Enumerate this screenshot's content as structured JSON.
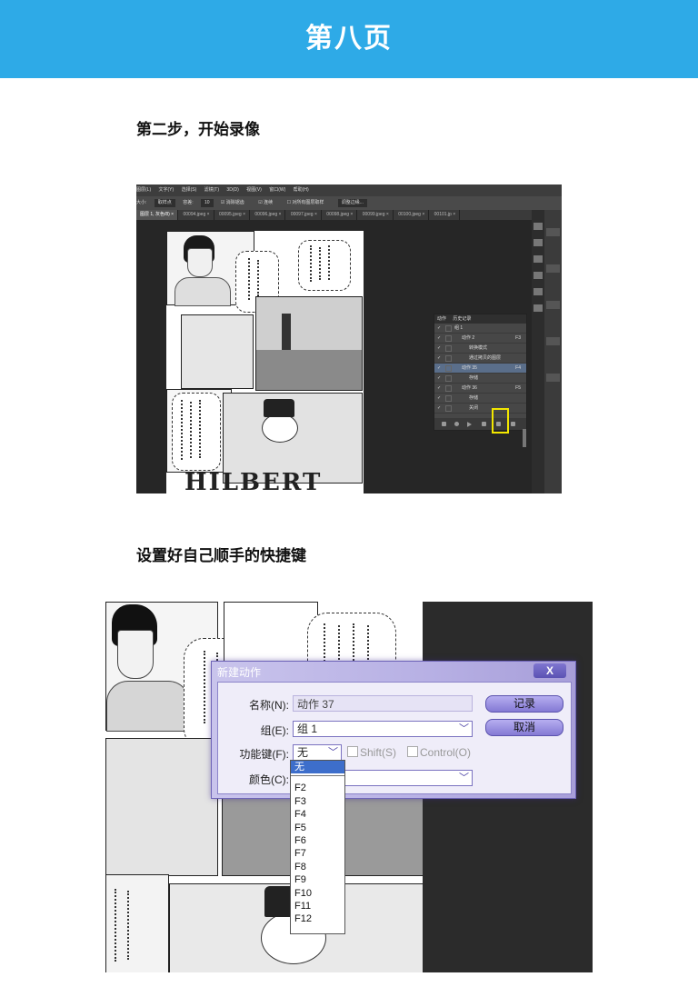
{
  "header": {
    "title": "第八页",
    "color": "#2eaae7"
  },
  "steps": {
    "step1": "第二步，开始录像",
    "step2": "设置好自己顺手的快捷键"
  },
  "ps": {
    "menus": [
      "图层(L)",
      "文字(Y)",
      "选择(S)",
      "滤镜(T)",
      "3D(D)",
      "视图(V)",
      "窗口(W)",
      "帮助(H)"
    ],
    "options": {
      "size_label": "大小:",
      "sample_select": "取样点",
      "tolerance_label": "容差:",
      "tolerance_value": "10",
      "antialias": "消除锯齿",
      "contiguous": "连续",
      "all_layers": "对所有图层取样",
      "refine_button": "调整边缘..."
    },
    "tabs": [
      "图层 1, 灰色/8) ×",
      "00094.jpeg ×",
      "00095.jpeg ×",
      "00096.jpeg ×",
      "00097.jpeg ×",
      "00098.jpeg ×",
      "00099.jpeg ×",
      "00100.jpeg ×",
      "00101.jp ×"
    ],
    "panel_tabs": [
      "动作",
      "历史记录"
    ],
    "actions": [
      {
        "label": "组 1",
        "key": "",
        "indent": 22
      },
      {
        "label": "动作 2",
        "key": "F3",
        "indent": 30
      },
      {
        "label": "转换模式",
        "key": "",
        "indent": 38
      },
      {
        "label": "通过拷贝的图层",
        "key": "",
        "indent": 38
      },
      {
        "label": "动作 35",
        "key": "F4",
        "indent": 30
      },
      {
        "label": "存储",
        "key": "",
        "indent": 38
      },
      {
        "label": "动作 36",
        "key": "F5",
        "indent": 30
      },
      {
        "label": "存储",
        "key": "",
        "indent": 38
      },
      {
        "label": "关闭",
        "key": "",
        "indent": 38
      }
    ],
    "highlight_color": "#f2e600"
  },
  "manga": {
    "title1": "HILBERT",
    "title2": "HILBERT"
  },
  "dialog": {
    "title": "新建动作",
    "close_label": "X",
    "name_label": "名称(N):",
    "name_value": "动作 37",
    "group_label": "组(E):",
    "group_value": "组 1",
    "fkey_label": "功能键(F):",
    "fkey_value": "无",
    "shift_label": "Shift(S)",
    "control_label": "Control(O)",
    "color_label": "颜色(C):",
    "color_value": "",
    "record_button": "记录",
    "cancel_button": "取消",
    "accent_color": "#8479d4"
  },
  "dropdown_options": [
    "无",
    "F2",
    "F3",
    "F4",
    "F5",
    "F6",
    "F7",
    "F8",
    "F9",
    "F10",
    "F11",
    "F12"
  ]
}
